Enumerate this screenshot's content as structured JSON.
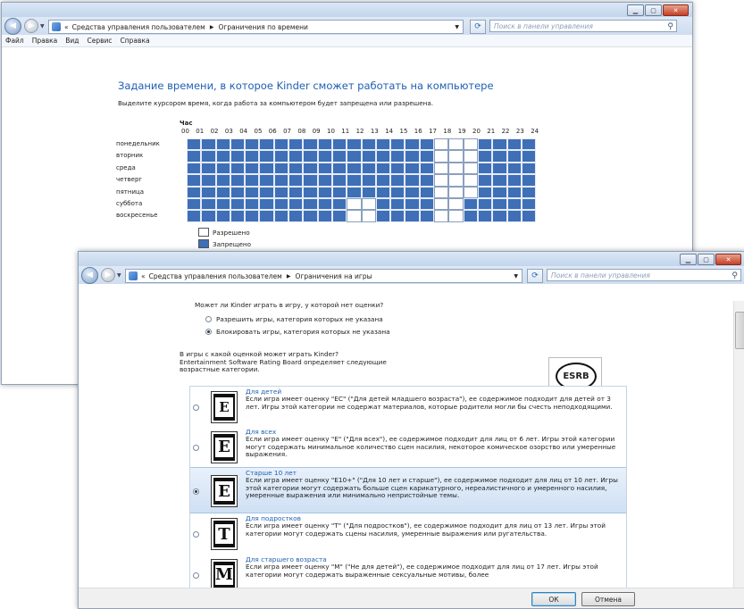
{
  "window1": {
    "breadcrumb": [
      "«",
      "Средства управления пользователем",
      "Ограничения по времени"
    ],
    "search_placeholder": "Поиск в панели управления",
    "menu": [
      "Файл",
      "Правка",
      "Вид",
      "Сервис",
      "Справка"
    ],
    "heading": "Задание времени, в которое Kinder сможет работать на компьютере",
    "instruction": "Выделите курсором время, когда работа за компьютером будет запрещена или разрешена.",
    "hour_label": "Час",
    "hours": [
      "00",
      "01",
      "02",
      "03",
      "04",
      "05",
      "06",
      "07",
      "08",
      "09",
      "10",
      "11",
      "12",
      "13",
      "14",
      "15",
      "16",
      "17",
      "18",
      "19",
      "20",
      "21",
      "22",
      "23",
      "24"
    ],
    "days": [
      {
        "name": "понедельник",
        "allowed": [
          17,
          18,
          19
        ]
      },
      {
        "name": "вторник",
        "allowed": [
          17,
          18,
          19
        ]
      },
      {
        "name": "среда",
        "allowed": [
          17,
          18,
          19
        ]
      },
      {
        "name": "четверг",
        "allowed": [
          17,
          18,
          19
        ]
      },
      {
        "name": "пятница",
        "allowed": [
          17,
          18,
          19
        ]
      },
      {
        "name": "суббота",
        "allowed": [
          11,
          12,
          17,
          18
        ]
      },
      {
        "name": "воскресенье",
        "allowed": [
          11,
          12,
          17,
          18
        ]
      }
    ],
    "legend": {
      "allowed": "Разрешено",
      "denied": "Запрещено"
    },
    "colors": {
      "denied": "#3f6fb6",
      "allowed": "#ffffff",
      "heading": "#1f5fb3"
    }
  },
  "window2": {
    "breadcrumb": [
      "«",
      "Средства управления пользователем",
      "Ограничения на игры"
    ],
    "search_placeholder": "Поиск в панели управления",
    "question": "Может ли Kinder играть в игру, у которой нет оценки?",
    "options": [
      {
        "label": "Разрешить игры, категория которых не указана",
        "selected": false
      },
      {
        "label": "Блокировать игры, категория которых не указана",
        "selected": true
      }
    ],
    "rating_intro": [
      "В игры с какой оценкой может играть Kinder?",
      "Entertainment Software Rating Board определяет следующие",
      "возрастные категории."
    ],
    "esrb_logo": "ESRB",
    "ratings": [
      {
        "badge": "EC",
        "name": "Для детей",
        "desc": "Если игра имеет оценку \"EC\" (\"Для детей младшего возраста\"), ее содержимое подходит для детей от 3 лет. Игры этой категории не содержат материалов, которые родители могли бы счесть неподходящими.",
        "selected": false,
        "highlight": false
      },
      {
        "badge": "E",
        "name": "Для всех",
        "desc": "Если игра имеет оценку \"E\" (\"Для всех\"), ее содержимое подходит для лиц от 6 лет. Игры этой категории могут содержать минимальное количество сцен насилия, некоторое комическое озорство или умеренные выражения.",
        "selected": false,
        "highlight": false
      },
      {
        "badge": "E10+",
        "name": "Старше 10 лет",
        "desc": "Если игра имеет оценку \"E10+\" (\"Для 10 лет и старше\"), ее содержимое подходит для лиц от 10 лет. Игры этой категории могут содержать больше сцен карикатурного, нереалистичного и умеренного насилия, умеренные выражения или минимально непристойные темы.",
        "selected": true,
        "highlight": true
      },
      {
        "badge": "T",
        "name": "Для подростков",
        "desc": "Если игра имеет оценку \"T\" (\"Для подростков\"), ее содержимое подходит для лиц от 13 лет.  Игры этой категории могут содержать сцены насилия, умеренные выражения или ругательства.",
        "selected": false,
        "highlight": false
      },
      {
        "badge": "M",
        "name": "Для старшего возраста",
        "desc": "Если игра имеет оценку \"M\" (\"Не для детей\"), ее содержимое подходит для лиц от 17 лет. Игры этой категории могут содержать выраженные сексуальные мотивы, более",
        "selected": false,
        "highlight": false
      }
    ],
    "ok_label": "ОК",
    "cancel_label": "Отмена"
  }
}
